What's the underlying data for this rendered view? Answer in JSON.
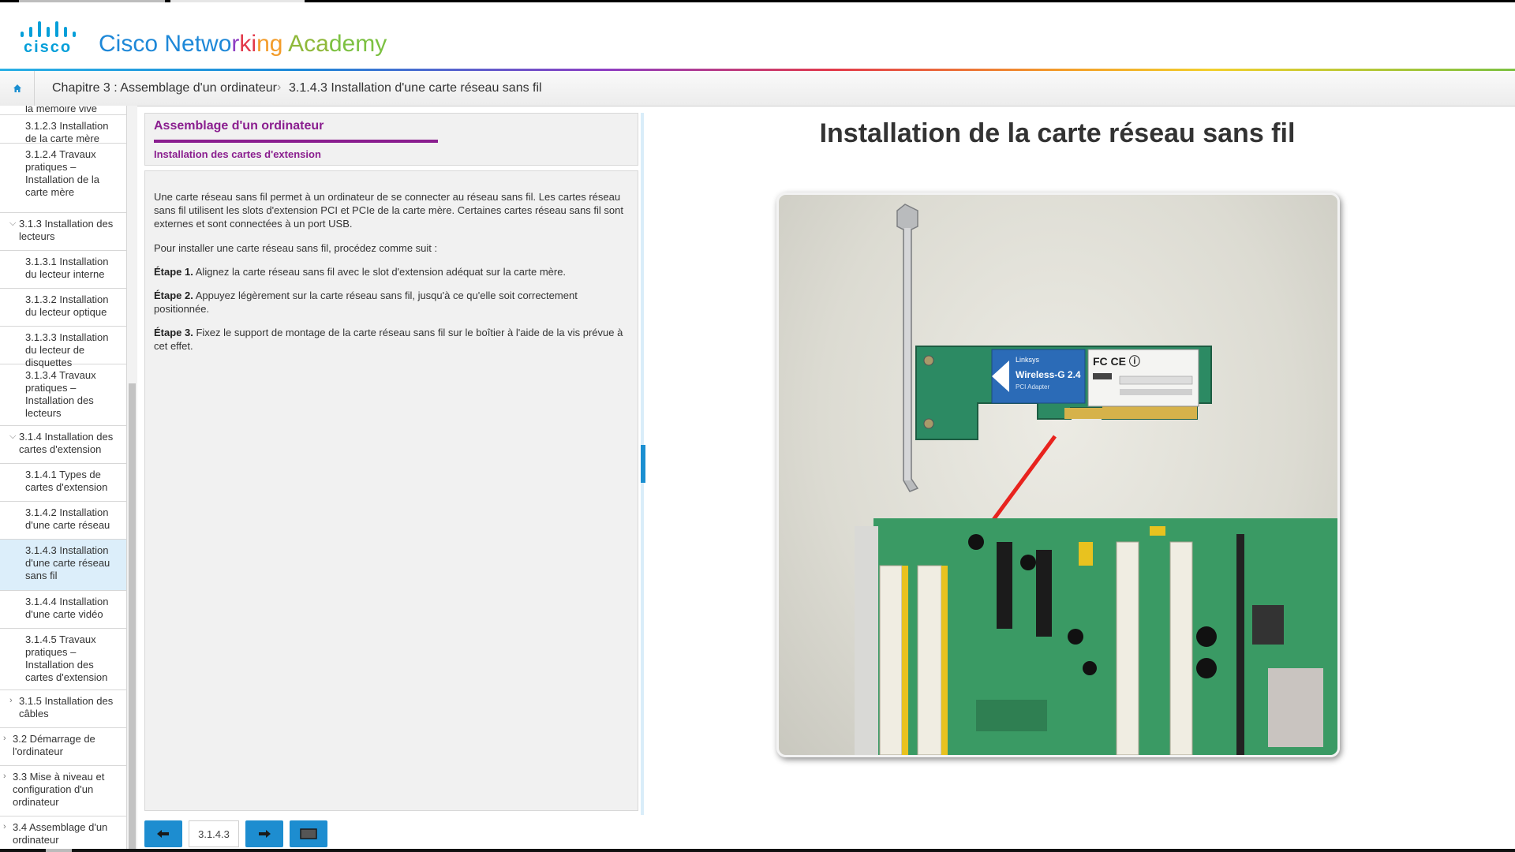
{
  "app": {
    "logo_word": "cisco",
    "title_parts": [
      "Cisco Netwo",
      "r",
      "ki",
      "ng ",
      "Aca",
      "demy"
    ],
    "title_colors": [
      "#1e88d8",
      "#8e3ec3",
      "#e23a4b",
      "#f39c2a",
      "#8fb83a",
      "#7cc142"
    ]
  },
  "breadcrumb": {
    "home_icon": "home-icon",
    "chapter": "Chapitre 3 : Assemblage d'un ordinateur",
    "page": "3.1.4.3 Installation d'une carte réseau sans fil"
  },
  "sidebar": {
    "items": [
      {
        "label": "la mémoire vive",
        "level": 2,
        "active": false
      },
      {
        "label": "3.1.2.3 Installation de la carte mère",
        "level": 2,
        "active": false
      },
      {
        "label": "3.1.2.4 Travaux pratiques – Installation de la carte mère",
        "level": 2,
        "active": false
      },
      {
        "label": "3.1.3 Installation des lecteurs",
        "level": 1,
        "expanded": true,
        "active": false
      },
      {
        "label": "3.1.3.1 Installation du lecteur interne",
        "level": 2,
        "active": false
      },
      {
        "label": "3.1.3.2 Installation du lecteur optique",
        "level": 2,
        "active": false
      },
      {
        "label": "3.1.3.3 Installation du lecteur de disquettes",
        "level": 2,
        "active": false
      },
      {
        "label": "3.1.3.4 Travaux pratiques – Installation des lecteurs",
        "level": 2,
        "active": false
      },
      {
        "label": "3.1.4 Installation des cartes d'extension",
        "level": 1,
        "expanded": true,
        "active": false
      },
      {
        "label": "3.1.4.1 Types de cartes d'extension",
        "level": 2,
        "active": false
      },
      {
        "label": "3.1.4.2 Installation d'une carte réseau",
        "level": 2,
        "active": false
      },
      {
        "label": "3.1.4.3 Installation d'une carte réseau sans fil",
        "level": 2,
        "active": true
      },
      {
        "label": "3.1.4.4 Installation d'une carte vidéo",
        "level": 2,
        "active": false
      },
      {
        "label": "3.1.4.5 Travaux pratiques – Installation des cartes d'extension",
        "level": 2,
        "active": false
      },
      {
        "label": "3.1.5 Installation des câbles",
        "level": 1,
        "expanded": false,
        "active": false
      },
      {
        "label": "3.2 Démarrage de l'ordinateur",
        "level": 0,
        "expanded": false,
        "active": false
      },
      {
        "label": "3.3 Mise à niveau et configuration d'un ordinateur",
        "level": 0,
        "expanded": false,
        "active": false
      },
      {
        "label": "3.4 Assemblage d'un ordinateur",
        "level": 0,
        "expanded": false,
        "active": false
      }
    ]
  },
  "content": {
    "section_title": "Assemblage d'un ordinateur",
    "section_subtitle": "Installation des cartes d'extension",
    "para1": "Une carte réseau sans fil permet à un ordinateur de se connecter au réseau sans fil. Les cartes réseau sans fil utilisent les slots d'extension PCI et PCIe de la carte mère. Certaines cartes réseau sans fil sont externes et sont connectées à un port USB.",
    "para2": "Pour installer une carte réseau sans fil, procédez comme suit :",
    "step1_label": "Étape 1.",
    "step1_text": " Alignez la carte réseau sans fil avec le slot d'extension adéquat sur la carte mère.",
    "step2_label": "Étape 2.",
    "step2_text": " Appuyez légèrement sur la carte réseau sans fil, jusqu'à ce qu'elle soit correctement positionnée.",
    "step3_label": "Étape 3.",
    "step3_text": " Fixez le support de montage de la carte réseau sans fil sur le boîtier à l'aide de la vis prévue à cet effet."
  },
  "footer": {
    "prev_icon": "arrow-left-icon",
    "page_number": "3.1.4.3",
    "next_icon": "arrow-right-icon",
    "media_icon": "screen-icon"
  },
  "media": {
    "title": "Installation de la carte réseau sans fil",
    "card_brand": "Linksys",
    "card_model": "Wireless-G 2.4",
    "card_sub": "PCI Adapter",
    "cert_marks": "FC CE ⓘ",
    "arrow_color": "#e8231e"
  }
}
